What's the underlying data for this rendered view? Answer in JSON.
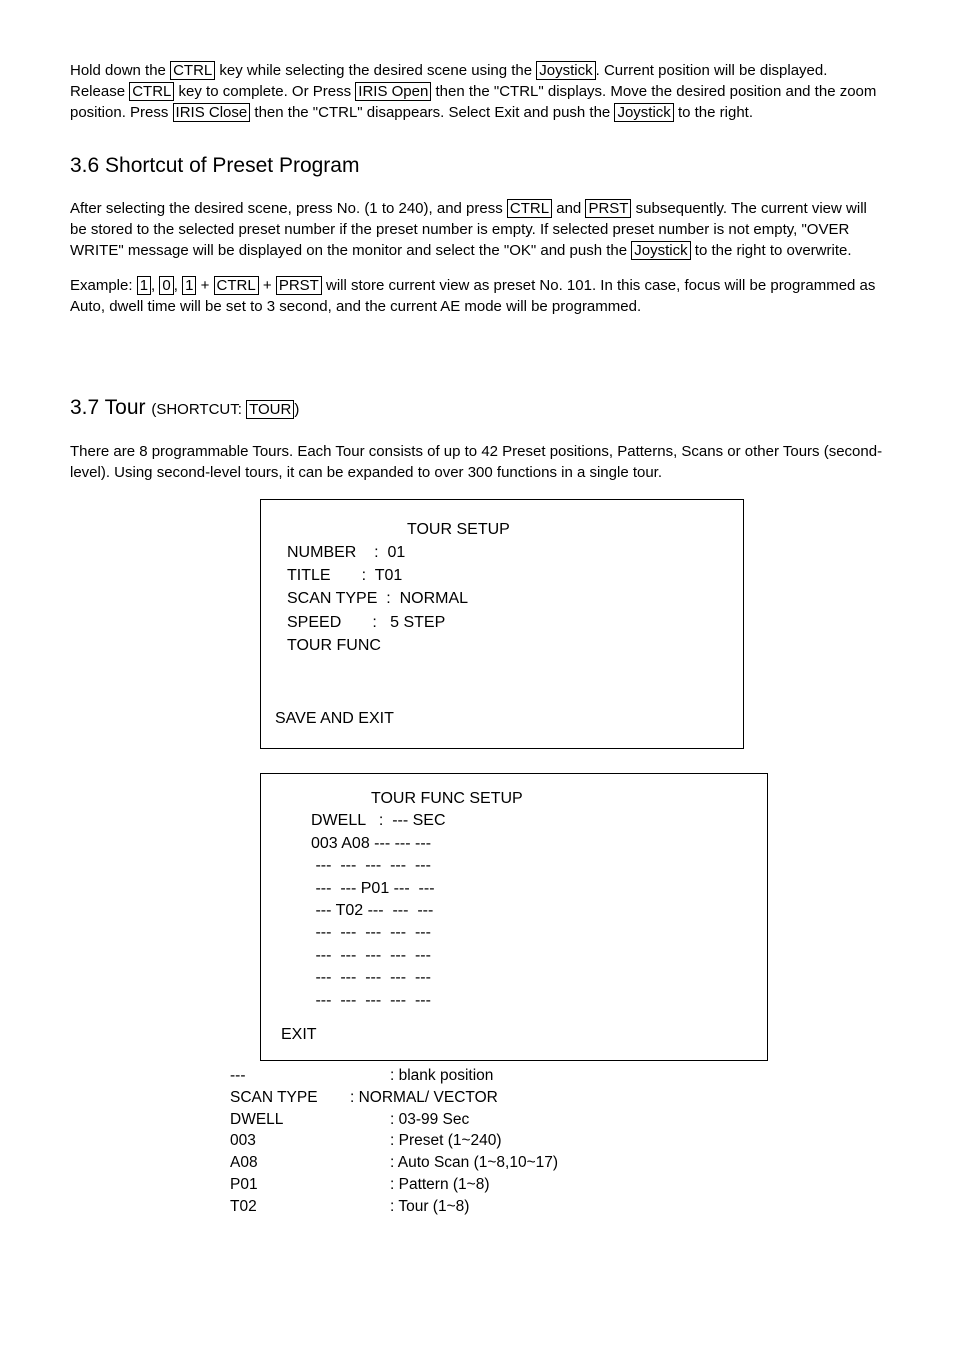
{
  "para1": {
    "t1": "Hold down the ",
    "ctrl": "CTRL",
    "t2": " key while selecting the desired scene using the ",
    "joystick": "Joystick",
    "t3": ". Current position will be displayed. Release ",
    "ctrl2": "CTRL",
    "t4": " key to complete. Or Press ",
    "irisopen": "IRIS Open",
    "t5": "  then the \"CTRL\" displays. Move the desired position and the zoom position. Press ",
    "irisclose": "IRIS Close",
    "t6": "  then the \"CTRL\" disappears. Select Exit and push the ",
    "joystick2": "Joystick",
    "t7": " to the right."
  },
  "h36": "3.6 Shortcut of Preset Program",
  "para2": {
    "t1": "After selecting the desired scene, press No. (1 to 240), and press ",
    "ctrl": "CTRL",
    "t2": " and  ",
    "prst": "PRST",
    "t3": " subsequently. The current view will be stored to the selected preset number if the preset number  is empty. If selected preset number is not empty, \"OVER WRITE\" message will be displayed on the monitor and select the \"OK\" and push the ",
    "joystick": "Joystick",
    "t4": " to the right to overwrite."
  },
  "para3": {
    "t1": "Example: ",
    "k1": "1",
    "c1": ", ",
    "k2": "0",
    "c2": ", ",
    "k3": "1",
    "c3": " + ",
    "ctrl": "CTRL",
    "c4": " + ",
    "prst": "PRST",
    "t2": " will store current view as preset No. 101. In this case, focus will be programmed as Auto, dwell time will be set to 3 second, and the current AE mode will be programmed."
  },
  "h37": {
    "main": "3.7 Tour ",
    "sub1": "(SHORTCUT: ",
    "tour": "TOUR",
    "sub2": ")"
  },
  "para4": "There are 8 programmable Tours. Each Tour consists of up to 42 Preset positions, Patterns, Scans or other Tours (second-level). Using second-level tours, it can be expanded to over 300 functions in a single tour.",
  "box1": {
    "title": "TOUR SETUP",
    "number": "NUMBER    :  01",
    "titleline": "TITLE       :  T01",
    "scantype": "SCAN TYPE  :  NORMAL",
    "speed": "SPEED       :   5 STEP",
    "tourfunc": "TOUR FUNC",
    "save": "SAVE AND EXIT"
  },
  "box2": {
    "title": "TOUR FUNC SETUP",
    "dwell": "DWELL   :  --- SEC",
    "l1": "003 A08 --- --- ---",
    "l2": " ---  ---  ---  ---  ---",
    "l3": " ---  --- P01 ---  ---",
    "l4": " --- T02 ---  ---  ---",
    "l5": " ---  ---  ---  ---  ---",
    "l6": " ---  ---  ---  ---  ---",
    "l7": " ---  ---  ---  ---  ---",
    "l8": " ---  ---  ---  ---  ---",
    "exit": "EXIT"
  },
  "legend": {
    "r0": {
      "k": "---",
      "v": ": blank position"
    },
    "r1": {
      "k": "SCAN TYPE",
      "v": ": NORMAL/ VECTOR"
    },
    "r2": {
      "k": "DWELL",
      "v": ": 03-99 Sec"
    },
    "r3": {
      "k": "003",
      "v": ": Preset (1~240)"
    },
    "r4": {
      "k": "A08",
      "v": ": Auto Scan (1~8,10~17)"
    },
    "r5": {
      "k": "P01",
      "v": ": Pattern (1~8)"
    },
    "r6": {
      "k": "T02",
      "v": ": Tour (1~8)"
    }
  }
}
